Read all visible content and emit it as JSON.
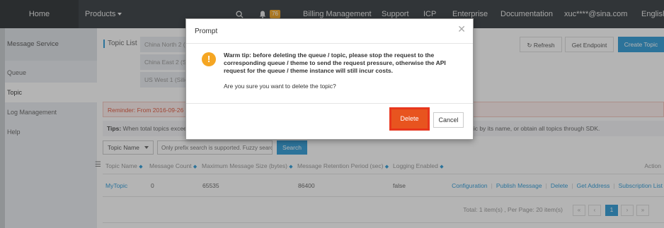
{
  "nav": {
    "home": "Home",
    "products": "Products",
    "notification_count": "76",
    "billing": "Billing Management",
    "support": "Support",
    "icp": "ICP",
    "enterprise": "Enterprise",
    "documentation": "Documentation",
    "user": "xuc****@sina.com",
    "language": "English"
  },
  "sidebar": {
    "title": "Message Service",
    "items": [
      "Queue",
      "Topic",
      "Log Management",
      "Help"
    ]
  },
  "main": {
    "topic_list_label": "Topic List",
    "regions": [
      "China North 2 (Beijing)",
      "China East 2 (Shanghai)",
      "US West 1 (Silicon Valley)"
    ],
    "refresh": "Refresh",
    "get_endpoint": "Get Endpoint",
    "create_topic": "Create Topic",
    "reminder": "Reminder: From 2016-09-26 the",
    "tips_label": "Tips:",
    "tips_text": "When total topics exceed",
    "tips_right": "topic by its name, or obtain all topics through SDK.",
    "filter_select": "Topic Name",
    "search_placeholder": "Only prefix search is supported. Fuzzy search",
    "search_button": "Search",
    "columns": [
      "Topic Name",
      "Message Count",
      "Maximum Message Size (bytes)",
      "Message Retention Period (sec)",
      "Logging Enabled",
      "Action"
    ],
    "row": {
      "name": "MyTopic",
      "count": "0",
      "max_size": "65535",
      "retention": "86400",
      "logging": "false",
      "actions": [
        "Configuration",
        "Publish Message",
        "Delete",
        "Get Address",
        "Subscription List"
      ]
    },
    "pagination": {
      "total": "Total: 1 item(s) , Per Page: 20 item(s)",
      "first": "«",
      "prev": "‹",
      "current": "1",
      "next": "›",
      "last": "»"
    }
  },
  "dialog": {
    "title": "Prompt",
    "close": "✕",
    "message": "Warm tip: before deleting the queue / topic, please stop the request to the corresponding queue / theme to send the request pressure, otherwise the API request for the queue / theme instance will still incur costs.",
    "confirm": "Are you sure you want to delete the topic?",
    "delete": "Delete",
    "cancel": "Cancel"
  },
  "colors": {
    "nav_bg": "#373d41",
    "primary": "#2f9cd8",
    "warning": "#f5a623",
    "danger": "#e8541f",
    "highlight_border": "#e8361d"
  }
}
